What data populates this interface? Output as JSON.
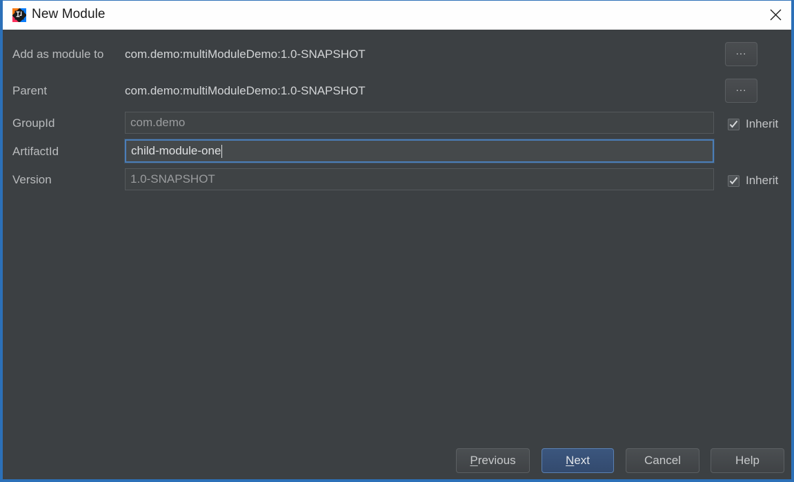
{
  "window": {
    "title": "New Module",
    "icon": "intellij-idea-icon",
    "close_label": "×",
    "accent_border": "#2c70b8",
    "background": "#3c4043",
    "titlebar_background": "#fefefe"
  },
  "form": {
    "rows": [
      {
        "label": "Add as module to",
        "type": "static",
        "value": "com.demo:multiModuleDemo:1.0-SNAPSHOT",
        "browse_label": "...",
        "has_browse": true,
        "has_inherit": false
      },
      {
        "label": "Parent",
        "type": "static",
        "value": "com.demo:multiModuleDemo:1.0-SNAPSHOT",
        "browse_label": "...",
        "has_browse": true,
        "has_inherit": false
      },
      {
        "label": "GroupId",
        "type": "input",
        "value": "com.demo",
        "state": "disabled",
        "has_browse": false,
        "has_inherit": true,
        "inherit_label": "Inherit",
        "inherit_checked": true
      },
      {
        "label": "ArtifactId",
        "type": "input",
        "value": "child-module-one",
        "state": "focused",
        "has_browse": false,
        "has_inherit": false
      },
      {
        "label": "Version",
        "type": "input",
        "value": "1.0-SNAPSHOT",
        "state": "disabled",
        "has_browse": false,
        "has_inherit": true,
        "inherit_label": "Inherit",
        "inherit_checked": true
      }
    ]
  },
  "footer": {
    "buttons": [
      {
        "label": "Previous",
        "mnemonic": "P",
        "rest": "revious",
        "default": false
      },
      {
        "label": "Next",
        "mnemonic": "N",
        "rest": "ext",
        "default": true
      },
      {
        "label": "Cancel",
        "mnemonic": "",
        "rest": "Cancel",
        "default": false
      },
      {
        "label": "Help",
        "mnemonic": "",
        "rest": "Help",
        "default": false
      }
    ]
  },
  "colors": {
    "accent_blue": "#2c70b8",
    "focus_border": "#4b7eb8",
    "default_button_fill": "#36527a",
    "panel": "#3c4043",
    "label_text": "#b9bbbd"
  }
}
